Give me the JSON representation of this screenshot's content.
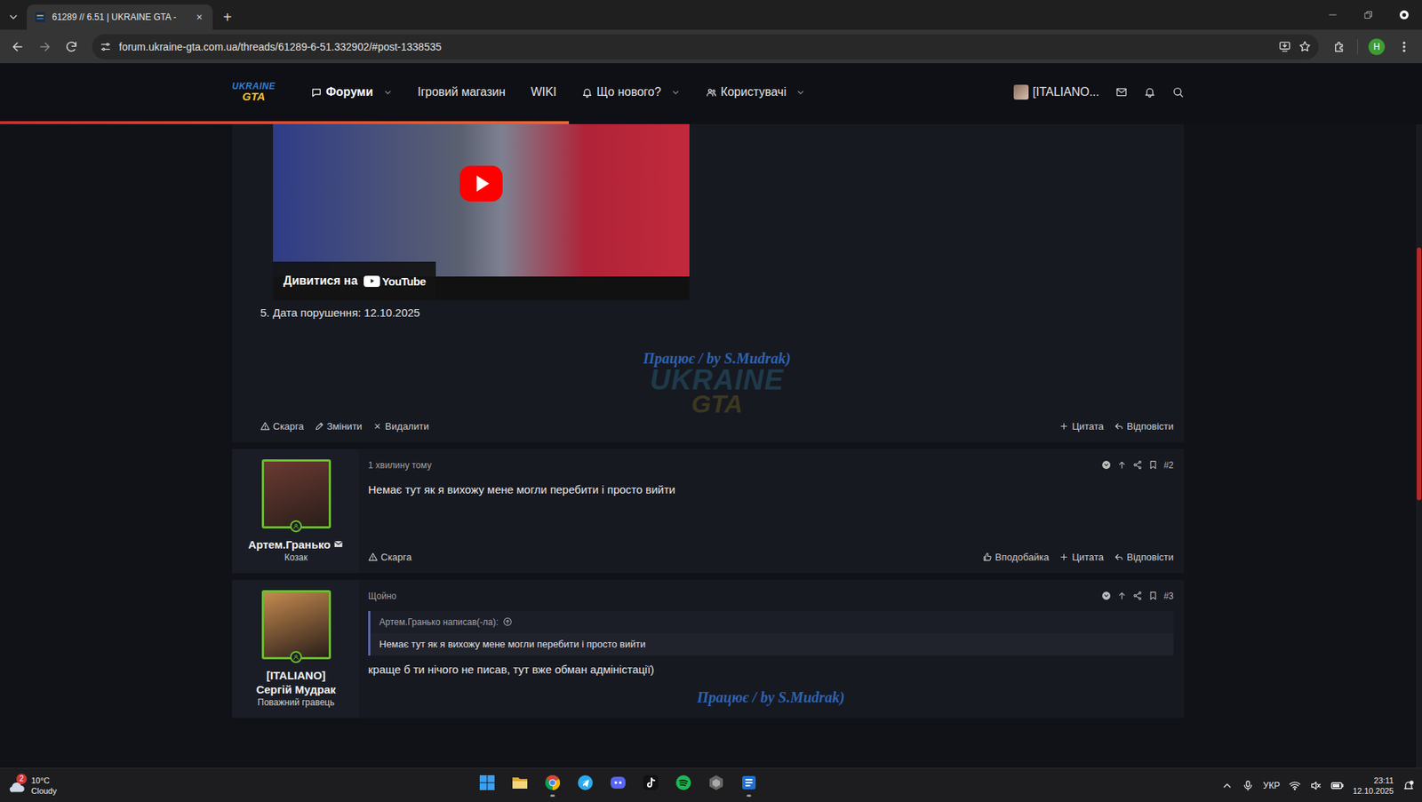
{
  "browser": {
    "tabs": [
      {
        "title": "61289 // 6.51 | UKRAINE GTA -",
        "selected": true,
        "close": "×"
      }
    ],
    "new_tab": "+",
    "address": "forum.ukraine-gta.com.ua/threads/61289-6-51.332902/#post-1338535",
    "profile": "H"
  },
  "site_header": {
    "logo": {
      "top": "UKRAINE",
      "bottom": "GTA"
    },
    "nav": [
      {
        "label": "Форуми",
        "kind": "forums",
        "selected": true,
        "dropdown": true
      },
      {
        "label": "Ігровий магазин",
        "kind": "plain",
        "selected": false,
        "dropdown": false
      },
      {
        "label": "WIKI",
        "kind": "plain",
        "selected": false,
        "dropdown": false
      },
      {
        "label": "Що нового?",
        "kind": "whatsnew",
        "selected": false,
        "dropdown": true
      },
      {
        "label": "Користувачі",
        "kind": "members",
        "selected": false,
        "dropdown": true
      }
    ],
    "user": "[ITALIANO..."
  },
  "read_progress": {
    "level": 0.4
  },
  "page_scroll": {
    "level": 0.29
  },
  "first_post": {
    "video": {
      "watch_label": "Дивитися на",
      "brand": "YouTube"
    },
    "details": "5. Дата порушення: 12.10.2025",
    "signature": "Працює / by S.Mudrak)",
    "signature_logo": {
      "top": "UKRAINE",
      "bottom": "GTA"
    },
    "actions_left": [
      {
        "label": "Скарга",
        "kind": "report"
      },
      {
        "label": "Змінити",
        "kind": "edit"
      },
      {
        "label": "Видалити",
        "kind": "delete"
      }
    ],
    "actions_right": [
      {
        "label": "Цитата",
        "kind": "quote"
      },
      {
        "label": "Відповісти",
        "kind": "reply"
      }
    ]
  },
  "posts": [
    {
      "author_lines": [
        "Артем.Гранько"
      ],
      "messageable": true,
      "online": true,
      "color": "#6b3a32",
      "user_title": "Козак",
      "time": "1 хвилину тому",
      "number": "#2",
      "text": "Немає тут як я вихожу мене могли перебити і просто вийти",
      "actions_left": [
        {
          "label": "Скарга",
          "kind": "report"
        }
      ],
      "actions_right": [
        {
          "label": "Вподобайка",
          "kind": "like"
        },
        {
          "label": "Цитата",
          "kind": "quote"
        },
        {
          "label": "Відповісти",
          "kind": "reply"
        }
      ]
    },
    {
      "author_lines": [
        "[ITALIANO]",
        "Сергій Мудрак"
      ],
      "messageable": false,
      "online": true,
      "color": "#c58a4e",
      "user_title": "Поважний гравець",
      "time": "Щойно",
      "number": "#3",
      "quote": {
        "author": "Артем.Гранько написав(-ла):",
        "text": "Немає тут як я вихожу мене могли перебити і просто вийти"
      },
      "text": "краще б ти нічого не писав, тут вже обман адміністації)",
      "signature": "Працює / by S.Mudrak)"
    }
  ],
  "taskbar": {
    "weather": {
      "badge": "2",
      "temp": "10°C",
      "desc": "Cloudy"
    },
    "apps": [
      {
        "kind": "start",
        "running": false
      },
      {
        "kind": "explorer",
        "running": false
      },
      {
        "kind": "chrome",
        "running": true
      },
      {
        "kind": "telegram",
        "running": false
      },
      {
        "kind": "discord",
        "running": false
      },
      {
        "kind": "tiktok",
        "running": false
      },
      {
        "kind": "spotify",
        "running": false
      },
      {
        "kind": "app",
        "running": false
      },
      {
        "kind": "editor",
        "running": true
      }
    ],
    "language": "УКР",
    "time": "23:11",
    "date": "12.10.2025",
    "volume_muted": true
  }
}
